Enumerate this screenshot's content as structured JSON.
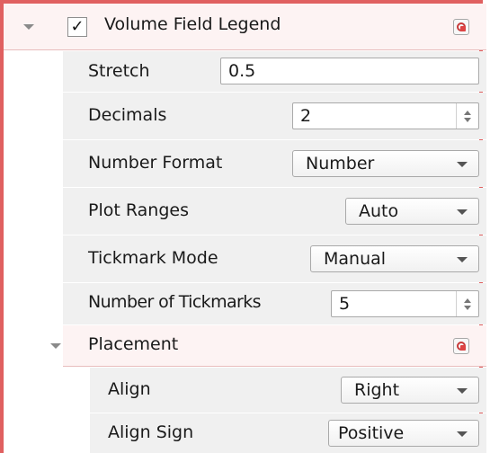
{
  "panel": {
    "section": {
      "title": "Volume Field Legend",
      "checked": true,
      "check_glyph": "✓",
      "reset_icon": "reset-defaults-icon"
    },
    "properties": [
      {
        "label": "Stretch",
        "control": "text",
        "value": "0.5"
      },
      {
        "label": "Decimals",
        "control": "spinbox",
        "value": "2"
      },
      {
        "label": "Number Format",
        "control": "dropdown",
        "value": "Number"
      },
      {
        "label": "Plot Ranges",
        "control": "dropdown",
        "value": "Auto"
      },
      {
        "label": "Tickmark Mode",
        "control": "dropdown",
        "value": "Manual"
      },
      {
        "label": "Number of Tickmarks",
        "control": "spinbox",
        "value": "5"
      }
    ],
    "placement": {
      "title": "Placement",
      "reset_icon": "reset-defaults-icon",
      "properties": [
        {
          "label": "Align",
          "control": "dropdown",
          "value": "Right"
        },
        {
          "label": "Align Sign",
          "control": "dropdown",
          "value": "Positive"
        }
      ]
    }
  },
  "colors": {
    "frame_border": "#e06060",
    "section_bg": "#fdf3f3",
    "row_bg": "#f0f0f0"
  }
}
